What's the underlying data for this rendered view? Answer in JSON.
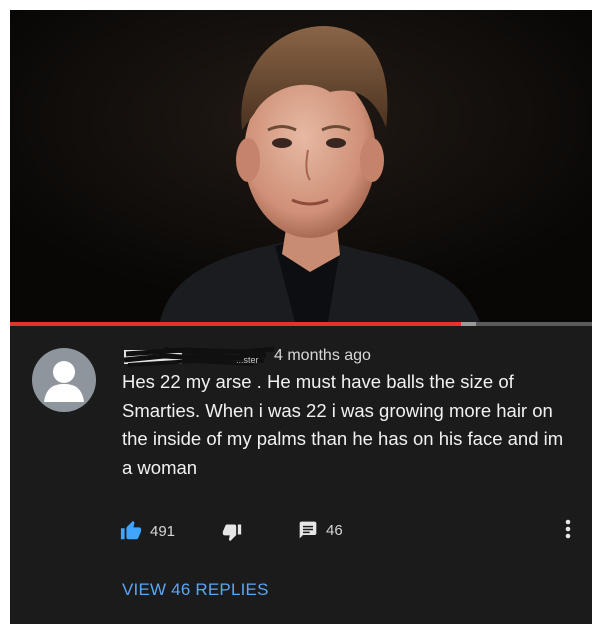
{
  "video": {
    "thumbnail_icon": "person-portrait-image",
    "progress_percent": 77.5,
    "buffered_percent": 2.5
  },
  "comment": {
    "author_icon": "default-avatar-icon",
    "author_name_redacted": true,
    "author_name_partial": "...ster",
    "timestamp": "4 months ago",
    "text": "Hes 22 my arse . He must have balls the size of Smarties.  When i was 22 i was growing more hair on the inside of my palms than he has on his face and im a woman",
    "likes": "491",
    "replies_count": "46",
    "view_replies_label": "VIEW 46 REPLIES",
    "like_icon": "thumbs-up-icon",
    "dislike_icon": "thumbs-down-icon",
    "reply_icon": "comment-icon",
    "more_icon": "more-vertical-icon"
  },
  "colors": {
    "background": "#1b1b1b",
    "progress_played": "#e4332b",
    "link": "#5aa5f3",
    "like_active": "#3ea6ff"
  }
}
